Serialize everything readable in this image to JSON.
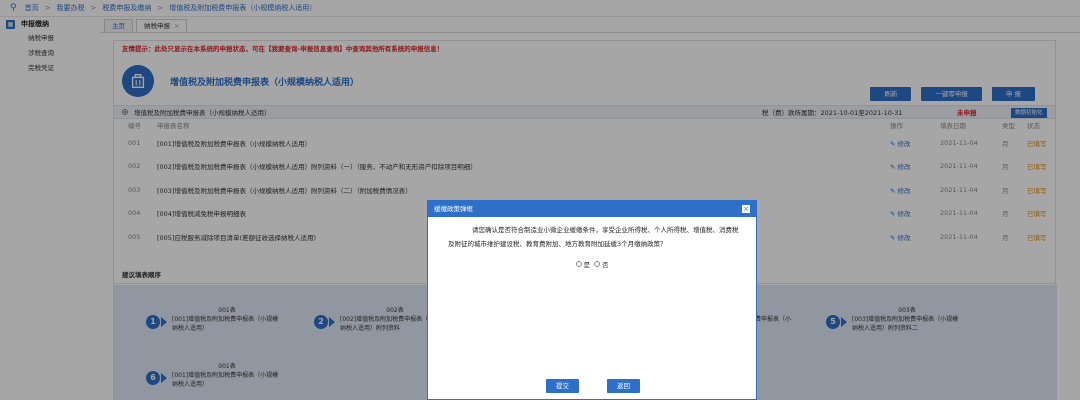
{
  "breadcrumb": {
    "items": [
      "首页",
      "我要办税",
      "税费申报及缴纳",
      "增值税及附加税费申报表（小规模纳税人适用）"
    ],
    "separator": ">"
  },
  "sidebar": {
    "title": "申报缴纳",
    "items": [
      {
        "label": "纳税申报"
      },
      {
        "label": "涉税查询"
      },
      {
        "label": "完税凭证"
      }
    ]
  },
  "tabs": [
    {
      "label": "主页",
      "active": false
    },
    {
      "label": "纳税申报",
      "active": true,
      "close": "×"
    }
  ],
  "main": {
    "alert": "友情提示：此处只显示在本系统的申报状态，可在【我要查询-申报信息查询】中查询其他所有系统的申报信息！",
    "form_title": "增值税及附加税费申报表（小规模纳税人适用）",
    "buttons": {
      "refresh": "刷新",
      "zero": "一键零申报",
      "submit": "申 报"
    },
    "section_label": "增值税及附加税费申报表（小规模纳税人适用）",
    "period": "税（费）款所属期：2021-10-01至2021-10-31",
    "status": "未申报",
    "init_button": "数据初始化"
  },
  "table": {
    "headers": {
      "no": "编号",
      "name": "申报表名称",
      "op": "操作",
      "date": "填表日期",
      "type": "类型",
      "status": "状态"
    },
    "rows": [
      {
        "no": "001",
        "name": "[001]增值税及附加税费申报表（小规模纳税人适用）",
        "op": "修改",
        "date": "2021-11-04",
        "type": "月",
        "status": "已填写"
      },
      {
        "no": "002",
        "name": "[002]增值税及附加税费申报表（小规模纳税人适用）附列资料（一）（服务、不动产和无形资产扣除项目明细）",
        "op": "修改",
        "date": "2021-11-04",
        "type": "月",
        "status": "已填写"
      },
      {
        "no": "003",
        "name": "[003]增值税及附加税费申报表（小规模纳税人适用）附列资料（二）（附加税费情况表）",
        "op": "修改",
        "date": "2021-11-04",
        "type": "月",
        "status": "已填写"
      },
      {
        "no": "004",
        "name": "[004]增值税减免税申报明细表",
        "op": "修改",
        "date": "2021-11-04",
        "type": "月",
        "status": "已填写"
      },
      {
        "no": "005",
        "name": "[005]应税服务减除项目清单(差额征收选择纳税人适用)",
        "op": "修改",
        "date": "2021-11-04",
        "type": "月",
        "status": "已填写"
      }
    ]
  },
  "suggest": {
    "title": "建议填表顺序",
    "steps": [
      {
        "num": "1",
        "code": "001表",
        "text": "[001]增值税及附加税费申报表（小规模纳税人适用）"
      },
      {
        "num": "2",
        "code": "002表",
        "text": "[002]增值税及附加税费申报表（小规模纳税人适用）附列资料"
      },
      {
        "num": "5",
        "code": "003表",
        "text": "[003]增值税及附加税费申报表（小规模纳税人适用）附列资料二"
      },
      {
        "num": "6",
        "code": "001表",
        "text": "[001]增值税及附加税费申报表（小规模纳税人适用）"
      }
    ],
    "step4_fragment": "税费申报表（小"
  },
  "modal": {
    "title": "缓缴政策弹框",
    "close": "×",
    "question": "请您确认是否符合制造业小微企业缓缴条件，享受企业所得税、个人所得税、增值税、消费税及附征的城市维护建设税、教育费附加、地方教育附加延缓3个月缴纳政策？",
    "opt_yes": "是",
    "opt_no": "否",
    "btn_submit": "提交",
    "btn_back": "返回"
  },
  "colors": {
    "primary": "#2e6fc7",
    "alert": "#d9232d",
    "status_filled": "#e08a00"
  }
}
